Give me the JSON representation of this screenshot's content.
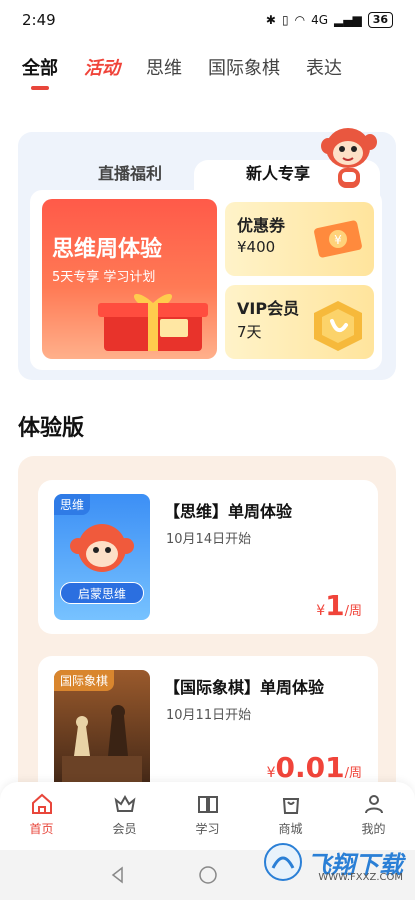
{
  "status": {
    "time": "2:49",
    "network": "4G",
    "battery": "36"
  },
  "tabs": [
    {
      "label": "全部"
    },
    {
      "label": "活动"
    },
    {
      "label": "思维"
    },
    {
      "label": "国际象棋"
    },
    {
      "label": "表达"
    }
  ],
  "promo": {
    "tab_welfare": "直播福利",
    "tab_new": "新人专享",
    "big_card": {
      "title": "思维周体验",
      "subtitle": "5天专享  学习计划"
    },
    "coupon": {
      "title": "优惠券",
      "value": "¥400"
    },
    "vip": {
      "title": "VIP会员",
      "value": "7天"
    }
  },
  "section": {
    "title": "体验版"
  },
  "courses": [
    {
      "tag": "思维",
      "badge": "启蒙思维",
      "title": "【思维】单周体验",
      "date": "10月14日开始",
      "currency": "¥",
      "price": "1",
      "unit": "/周"
    },
    {
      "tag": "国际象棋",
      "title": "【国际象棋】单周体验",
      "date": "10月11日开始",
      "currency": "¥",
      "price": "0.01",
      "unit": "/周"
    }
  ],
  "bottom_nav": [
    {
      "label": "首页",
      "icon": "home-icon"
    },
    {
      "label": "会员",
      "icon": "crown-icon"
    },
    {
      "label": "学习",
      "icon": "book-icon"
    },
    {
      "label": "商城",
      "icon": "bag-icon"
    },
    {
      "label": "我的",
      "icon": "user-icon"
    }
  ],
  "watermark": {
    "title": "飞翔下载",
    "url": "WWW.FXXZ.COM"
  },
  "colors": {
    "accent": "#e8463b",
    "promo_bg": "#eef3fb",
    "list_bg": "#fbefe5"
  }
}
